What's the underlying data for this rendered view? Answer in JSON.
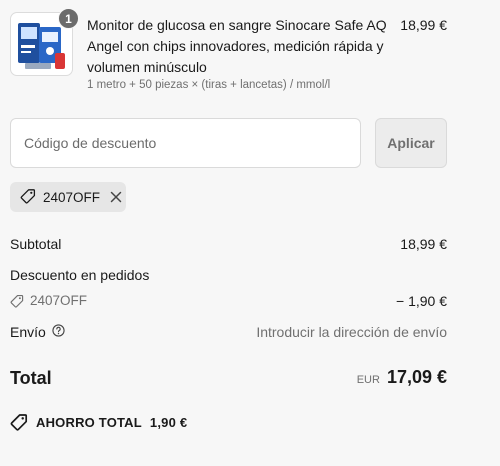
{
  "product": {
    "quantity_badge": "1",
    "title": "Monitor de glucosa en sangre Sinocare Safe AQ Angel con chips innovadores, medición rápida y volumen minúsculo",
    "variant": "1 metro + 50 piezas × (tiras + lancetas) / mmol/l",
    "price": "18,99 €",
    "thumbnail_icon": "glucose-monitor-product-image"
  },
  "discount": {
    "placeholder": "Código de descuento",
    "value": "",
    "apply_label": "Aplicar",
    "applied_code": "2407OFF"
  },
  "summary": {
    "subtotal_label": "Subtotal",
    "subtotal_value": "18,99 €",
    "order_discount_label": "Descuento en pedidos",
    "order_discount_code": "2407OFF",
    "order_discount_value": "− 1,90 €",
    "shipping_label": "Envío",
    "shipping_value": "Introducir la dirección de envío",
    "total_label": "Total",
    "total_currency": "EUR",
    "total_value": "17,09 €",
    "savings_label": "AHORRO TOTAL",
    "savings_value": "1,90 €"
  },
  "colors": {
    "background": "#f7f7f7",
    "text": "#1a1a1a",
    "muted": "#707070",
    "badge": "#6b6b6b",
    "chip": "#e6e6e6"
  }
}
